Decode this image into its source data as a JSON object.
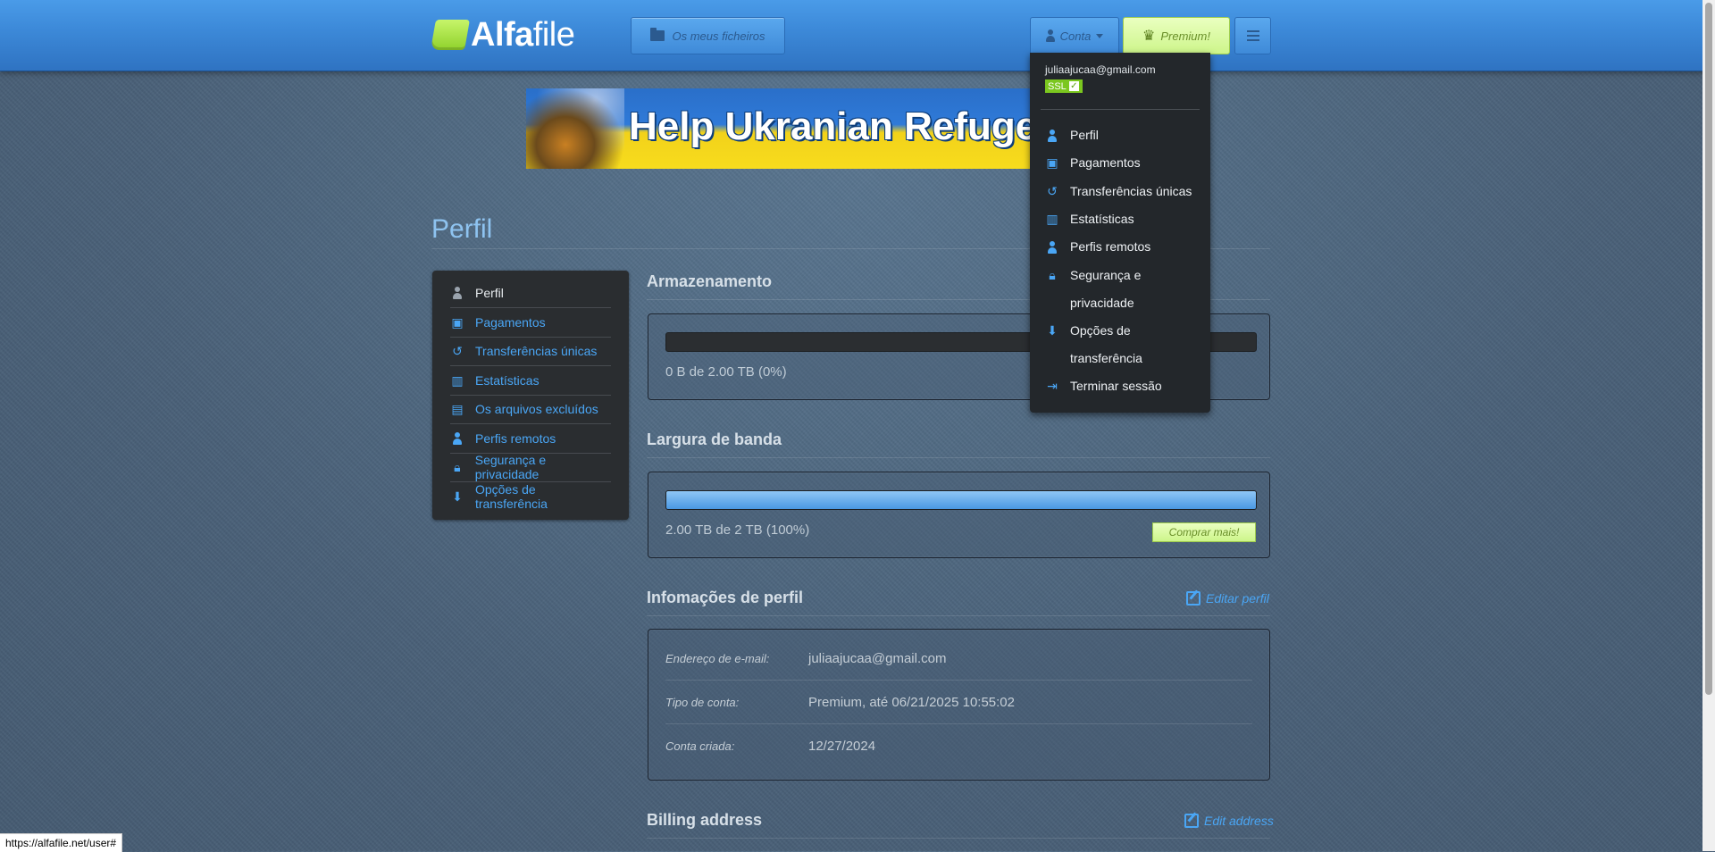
{
  "header": {
    "logo_bold": "Alfa",
    "logo_rest": "file",
    "files_button": "Os meus ficheiros",
    "account_button": "Conta",
    "premium_button": "Premium!"
  },
  "banner": {
    "text": "Help Ukranian Refugees"
  },
  "page": {
    "title": "Perfil"
  },
  "sidebar": {
    "items": [
      {
        "label": "Perfil",
        "icon": "person-icon"
      },
      {
        "label": "Pagamentos",
        "icon": "wallet-icon"
      },
      {
        "label": "Transferências únicas",
        "icon": "history-icon"
      },
      {
        "label": "Estatísticas",
        "icon": "bar-chart-icon"
      },
      {
        "label": "Os arquivos excluídos",
        "icon": "trash-files-icon"
      },
      {
        "label": "Perfis remotos",
        "icon": "remote-user-icon"
      },
      {
        "label": "Segurança e privacidade",
        "icon": "lock-icon"
      },
      {
        "label": "Opções de transferência",
        "icon": "download-icon"
      }
    ]
  },
  "storage": {
    "title": "Armazenamento",
    "label": "0 B de 2.00 TB (0%)",
    "fraction": 0
  },
  "bandwidth": {
    "title": "Largura de banda",
    "label": "2.00 TB de 2 TB (100%)",
    "fraction": 1,
    "buy_more": "Comprar mais!"
  },
  "profile_info": {
    "title": "Infomações de perfil",
    "edit_label": "Editar perfil",
    "rows": [
      {
        "label": "Endereço de e-mail:",
        "value": "juliaajucaa@gmail.com"
      },
      {
        "label": "Tipo de conta:",
        "value": "Premium, até 06/21/2025 10:55:02"
      },
      {
        "label": "Conta criada:",
        "value": "12/27/2024"
      }
    ]
  },
  "billing": {
    "title": "Billing address",
    "edit_label": "Edit address"
  },
  "dropdown": {
    "email": "juliaajucaa@gmail.com",
    "ssl": "SSL",
    "items": [
      {
        "label": "Perfil",
        "icon": "person-icon"
      },
      {
        "label": "Pagamentos",
        "icon": "wallet-icon"
      },
      {
        "label": "Transferências únicas",
        "icon": "history-icon"
      },
      {
        "label": "Estatísticas",
        "icon": "bar-chart-icon"
      },
      {
        "label": "Perfis remotos",
        "icon": "remote-user-icon"
      },
      {
        "label": "Segurança e",
        "label2": "privacidade",
        "icon": "lock-icon"
      },
      {
        "label": "Opções de",
        "label2": "transferência",
        "icon": "download-icon"
      },
      {
        "label": "Terminar sessão",
        "icon": "logout-icon"
      }
    ]
  },
  "statusbar": {
    "url": "https://alfafile.net/user#"
  },
  "colors": {
    "accent": "#4aa6f5",
    "header": "#3d8ad9",
    "premium": "#cdf58a"
  }
}
